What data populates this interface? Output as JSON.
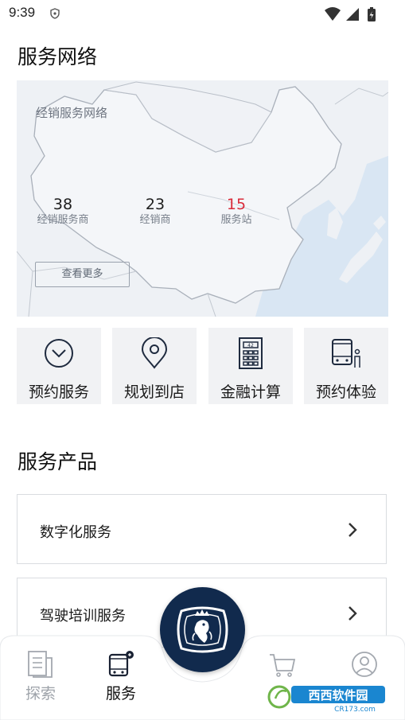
{
  "status_bar": {
    "time": "9:39"
  },
  "network": {
    "section_title": "服务网络",
    "map_title": "经销服务网络",
    "stats": [
      {
        "value": "38",
        "label": "经销服务商"
      },
      {
        "value": "23",
        "label": "经销商"
      },
      {
        "value": "15",
        "label": "服务站",
        "color": "#d92b3a"
      }
    ],
    "more_button": "查看更多"
  },
  "quick_actions": [
    {
      "label": "预约服务",
      "icon": "clock-icon"
    },
    {
      "label": "规划到店",
      "icon": "location-pin-icon"
    },
    {
      "label": "金融计算",
      "icon": "calculator-icon"
    },
    {
      "label": "预约体验",
      "icon": "bus-person-icon"
    }
  ],
  "products": {
    "section_title": "服务产品",
    "items": [
      {
        "label": "数字化服务"
      },
      {
        "label": "驾驶培训服务"
      }
    ]
  },
  "tab_bar": {
    "tabs": [
      {
        "label": "探索",
        "icon": "document-icon",
        "active": false
      },
      {
        "label": "服务",
        "icon": "bus-wrench-icon",
        "active": true
      },
      {
        "label": "",
        "icon": "cart-icon",
        "active": false
      },
      {
        "label": "",
        "icon": "profile-icon",
        "active": false
      }
    ],
    "center_button_icon": "griffin-logo-icon"
  },
  "watermark": {
    "brand": "西西软件园",
    "url": "CR173.com"
  },
  "colors": {
    "accent_navy": "#112a4d",
    "highlight_red": "#d92b3a",
    "tile_bg": "#f1f2f4"
  }
}
